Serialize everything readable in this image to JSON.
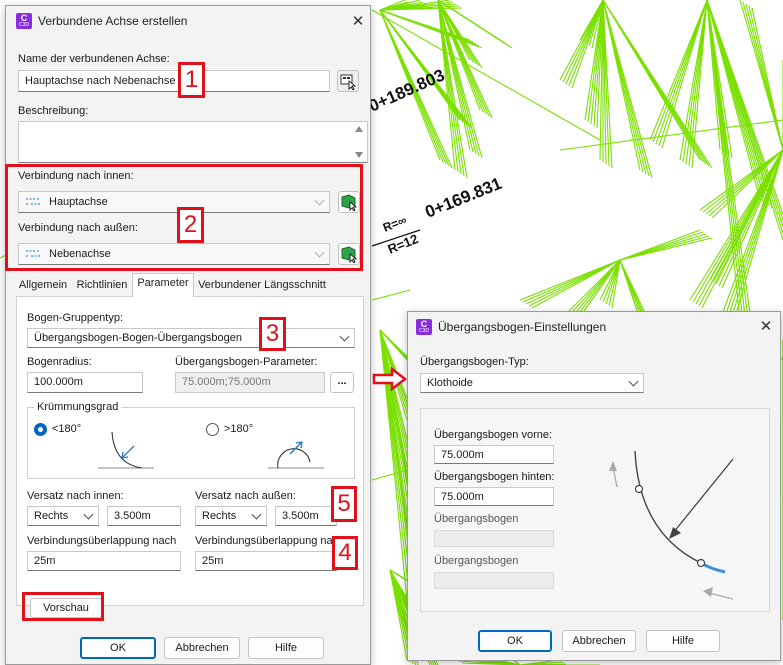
{
  "main_dialog": {
    "title": "Verbundene Achse erstellen",
    "app_icon": "C",
    "app_icon_sub": "C3D",
    "name_label": "Name der verbundenen Achse:",
    "name_value": "Hauptachse nach Nebenachse",
    "description_label": "Beschreibung:",
    "connection_inner_label": "Verbindung nach innen:",
    "connection_inner_value": "Hauptachse",
    "connection_outer_label": "Verbindung nach außen:",
    "connection_outer_value": "Nebenachse",
    "tabs": [
      "Allgemein",
      "Richtlinien",
      "Parameter",
      "Verbundener Längsschnitt"
    ],
    "active_tab": "Parameter",
    "curve_group_type_label": "Bogen-Gruppentyp:",
    "curve_group_type_value": "Übergangsbogen-Bogen-Übergangsbogen",
    "curve_radius_label": "Bogenradius:",
    "curve_radius_value": "100.000m",
    "transition_params_label": "Übergangsbogen-Parameter:",
    "transition_params_value": "75.000m;75.000m",
    "ellipsis_label": "...",
    "curvature_group_label": "Krümmungsgrad",
    "curvature_lt180": "<180°",
    "curvature_gt180": ">180°",
    "offset_inner_label": "Versatz nach innen:",
    "offset_inner_side": "Rechts",
    "offset_inner_value": "3.500m",
    "offset_outer_label": "Versatz nach außen:",
    "offset_outer_side": "Rechts",
    "offset_outer_value": "3.500m",
    "overlap_inner_label": "Verbindungsüberlappung nach",
    "overlap_inner_value": "25m",
    "overlap_outer_label": "Verbindungsüberlappung nach",
    "overlap_outer_value": "25m",
    "preview_button": "Vorschau",
    "ok_button": "OK",
    "cancel_button": "Abbrechen",
    "help_button": "Hilfe"
  },
  "transition_dialog": {
    "title": "Übergangsbogen-Einstellungen",
    "type_label": "Übergangsbogen-Typ:",
    "type_value": "Klothoide",
    "front_label": "Übergangsbogen vorne:",
    "front_value": "75.000m",
    "back_label": "Übergangsbogen hinten:",
    "back_value": "75.000m",
    "extra1_label": "Übergangsbogen",
    "extra2_label": "Übergangsbogen",
    "ok_button": "OK",
    "cancel_button": "Abbrechen",
    "help_button": "Hilfe"
  },
  "callouts": [
    "1",
    "2",
    "3",
    "4",
    "5"
  ],
  "drawing": {
    "station_1": "0+189.803",
    "station_2": "0+169.831",
    "radius_top": "R=∞",
    "radius_bottom": "R=12"
  },
  "colors": {
    "tin_lines": "#7be000",
    "highlight_red": "#e1101b",
    "accent_blue": "#0067c0",
    "curve_blue": "#3a8fd8"
  },
  "icons": {
    "pick_button": "pick-from-drawing-icon",
    "select_alignment": "select-alignment-icon",
    "alignment": "alignment-icon",
    "arrow": "right-arrow-icon"
  }
}
